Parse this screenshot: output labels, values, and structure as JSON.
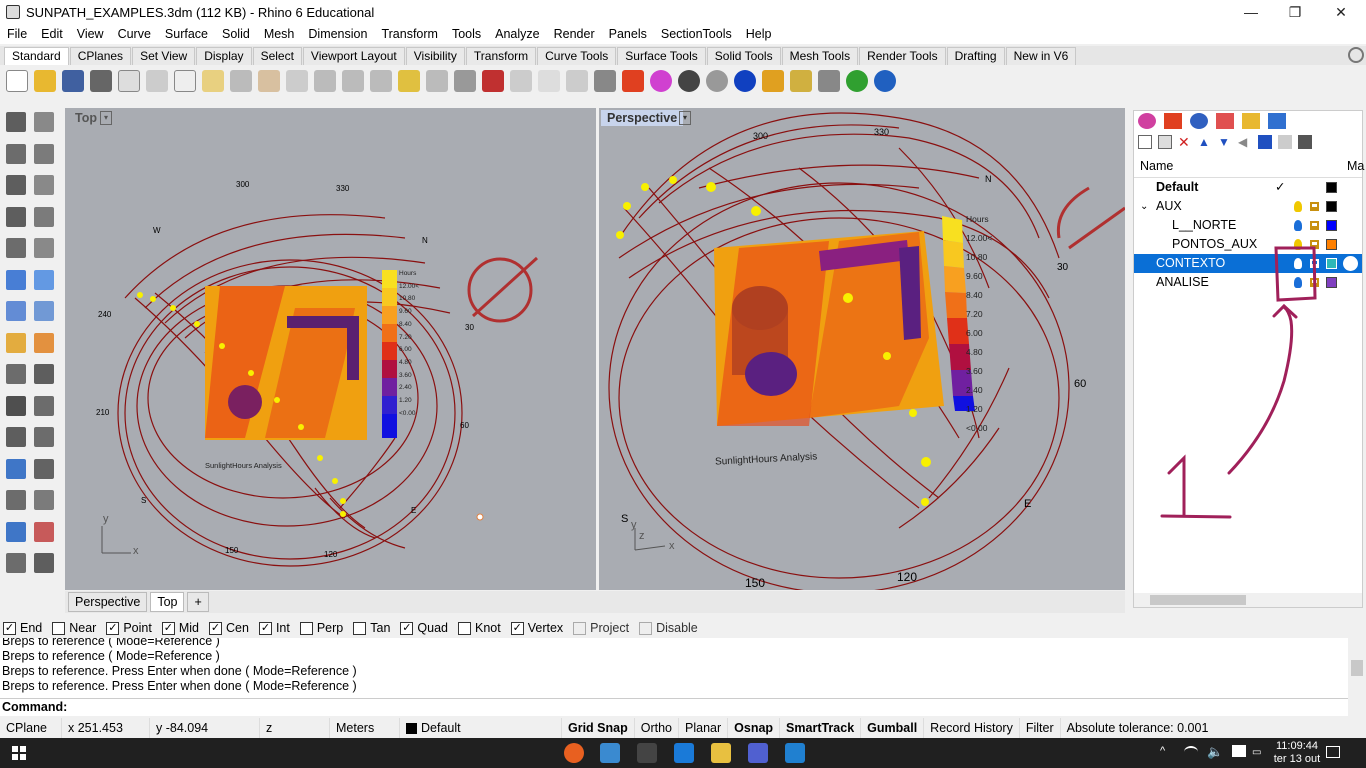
{
  "window": {
    "title": "SUNPATH_EXAMPLES.3dm (112 KB) - Rhino 6 Educational",
    "controls": {
      "minimize": "—",
      "restore": "❐",
      "close": "✕"
    }
  },
  "menu": [
    "File",
    "Edit",
    "View",
    "Curve",
    "Surface",
    "Solid",
    "Mesh",
    "Dimension",
    "Transform",
    "Tools",
    "Analyze",
    "Render",
    "Panels",
    "SectionTools",
    "Help"
  ],
  "toolbar_tabs": [
    "Standard",
    "CPlanes",
    "Set View",
    "Display",
    "Select",
    "Viewport Layout",
    "Visibility",
    "Transform",
    "Curve Tools",
    "Surface Tools",
    "Solid Tools",
    "Mesh Tools",
    "Render Tools",
    "Drafting",
    "New in V6"
  ],
  "active_toolbar_tab": "Standard",
  "viewports": {
    "top": {
      "title": "Top",
      "legend_title": "Hours",
      "legend_values": [
        "12.00<",
        "10.80",
        "9.60",
        "8.40",
        "7.20",
        "6.00",
        "4.80",
        "3.60",
        "2.40",
        "1.20",
        "<0.00"
      ],
      "label": "SunlightHours Analysis",
      "angles": [
        "300",
        "330",
        "240",
        "30",
        "210",
        "60",
        "150",
        "120"
      ],
      "directions": [
        "W",
        "N",
        "S",
        "E"
      ],
      "axes": {
        "x": "x",
        "y": "y"
      }
    },
    "perspective": {
      "title": "Perspective",
      "legend_title": "Hours",
      "legend_values": [
        "12.00<",
        "10.80",
        "9.60",
        "8.40",
        "7.20",
        "6.00",
        "4.80",
        "3.60",
        "2.40",
        "1.20",
        "<0.00"
      ],
      "label": "SunlightHours Analysis",
      "angles": [
        "300",
        "330",
        "30",
        "60",
        "150",
        "120"
      ],
      "directions": [
        "N",
        "S",
        "E"
      ],
      "axes": {
        "x": "x",
        "y": "y",
        "z": "z"
      }
    }
  },
  "viewport_tabs": [
    "Perspective",
    "Top",
    "+"
  ],
  "active_viewport_tab": "Top",
  "layers": {
    "header": {
      "name": "Name",
      "ma": "Ma"
    },
    "rows": [
      {
        "name": "Default",
        "indent": 0,
        "bold": true,
        "current": true,
        "color": "#000000",
        "selected": false,
        "bulb": ""
      },
      {
        "name": "AUX",
        "indent": 0,
        "expander": "⌄",
        "color": "#000000",
        "selected": false,
        "bulb": "#f0c800"
      },
      {
        "name": "L__NORTE",
        "indent": 1,
        "color": "#0000ff",
        "selected": false,
        "bulb": "#1a6ed8"
      },
      {
        "name": "PONTOS_AUX",
        "indent": 1,
        "color": "#ff8000",
        "selected": false,
        "bulb": "#f0c800"
      },
      {
        "name": "CONTEXTO",
        "indent": 0,
        "color": "#2eb8b8",
        "selected": true,
        "bulb": "#ffffff"
      },
      {
        "name": "ANALISE",
        "indent": 0,
        "color": "#8040c0",
        "selected": false,
        "bulb": "#1a6ed8"
      }
    ],
    "current_mark": "✓",
    "annotation": "1",
    "annotation_color": "#a0205a"
  },
  "osnaps": [
    {
      "label": "End",
      "checked": true
    },
    {
      "label": "Near",
      "checked": false
    },
    {
      "label": "Point",
      "checked": true
    },
    {
      "label": "Mid",
      "checked": true
    },
    {
      "label": "Cen",
      "checked": true
    },
    {
      "label": "Int",
      "checked": true
    },
    {
      "label": "Perp",
      "checked": false
    },
    {
      "label": "Tan",
      "checked": false
    },
    {
      "label": "Quad",
      "checked": true
    },
    {
      "label": "Knot",
      "checked": false
    },
    {
      "label": "Vertex",
      "checked": true
    },
    {
      "label": "Project",
      "checked": false,
      "disabled": true
    },
    {
      "label": "Disable",
      "checked": false,
      "disabled": true
    }
  ],
  "command_history": [
    "Breps to reference ( Mode=Reference )",
    "Breps to reference ( Mode=Reference )",
    "Breps to reference. Press Enter when done ( Mode=Reference )",
    "Breps to reference. Press Enter when done ( Mode=Reference )"
  ],
  "command_prompt": "Command:",
  "status": {
    "cplane": "CPlane",
    "x": "x 251.453",
    "y": "y -84.094",
    "z": "z",
    "units": "Meters",
    "layer": "Default",
    "toggles": [
      {
        "label": "Grid Snap",
        "bold": true
      },
      {
        "label": "Ortho",
        "bold": false
      },
      {
        "label": "Planar",
        "bold": false
      },
      {
        "label": "Osnap",
        "bold": true
      },
      {
        "label": "SmartTrack",
        "bold": true
      },
      {
        "label": "Gumball",
        "bold": true
      },
      {
        "label": "Record History",
        "bold": false
      },
      {
        "label": "Filter",
        "bold": false
      }
    ],
    "tolerance": "Absolute tolerance: 0.001"
  },
  "taskbar": {
    "time": "11:09:44",
    "date": "ter 13 out"
  }
}
